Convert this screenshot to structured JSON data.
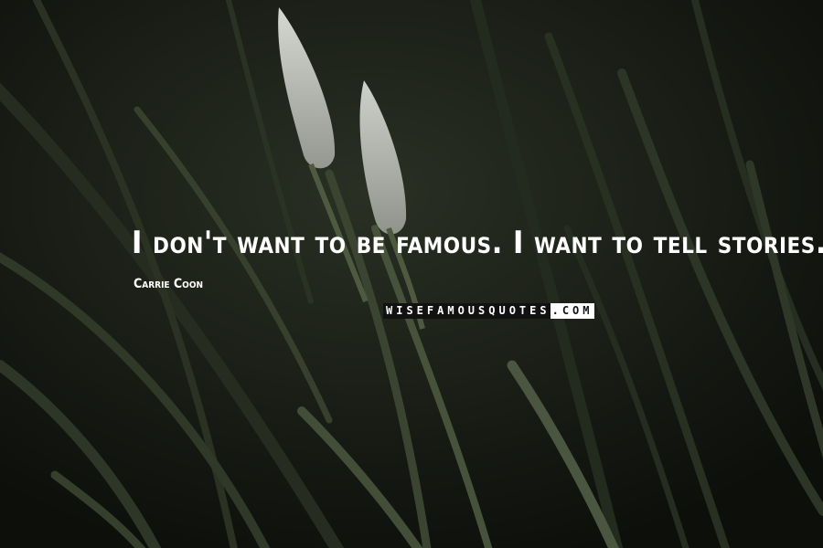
{
  "quote": {
    "text": "I don't want to be famous. I want to tell stories."
  },
  "author": {
    "name": "Carrie Coon"
  },
  "watermark": {
    "dark_part": "WISEFAMOUSQUOTES",
    "light_part": ".COM"
  },
  "colors": {
    "text": "#ffffff",
    "background": "#141610",
    "grass": "#3c4533"
  }
}
